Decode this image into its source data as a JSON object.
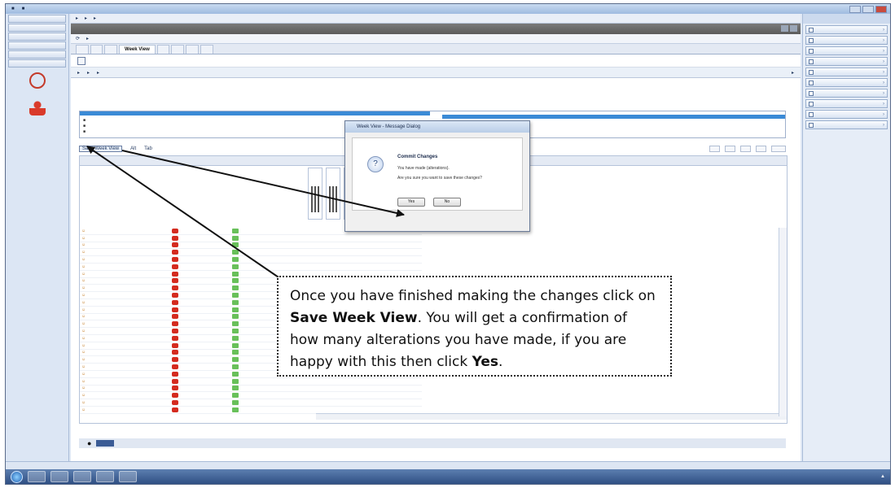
{
  "callout": {
    "part1": "Once you have finished making the changes click on ",
    "save_bold": "Save Week View",
    "part2": ". You will get a confirmation of how many alterations you have made, if you are happy with this then click ",
    "yes_bold": "Yes",
    "part3": "."
  },
  "dialog": {
    "title": "Week View - Message Dialog",
    "heading": "Commit Changes",
    "line1": "You have made {alterations}.",
    "line2": "Are you sure you want to save these changes?",
    "yes_label": "Yes",
    "no_label": "No"
  },
  "grid_toolbar": {
    "save_label": "Save Week View",
    "alt_label": "Alt",
    "tab_label": "Tab"
  },
  "main_tabs": [
    "Week View"
  ],
  "icons": [
    "start-orb-icon",
    "person-icon",
    "clock-icon",
    "question-icon",
    "arrow-icon"
  ]
}
